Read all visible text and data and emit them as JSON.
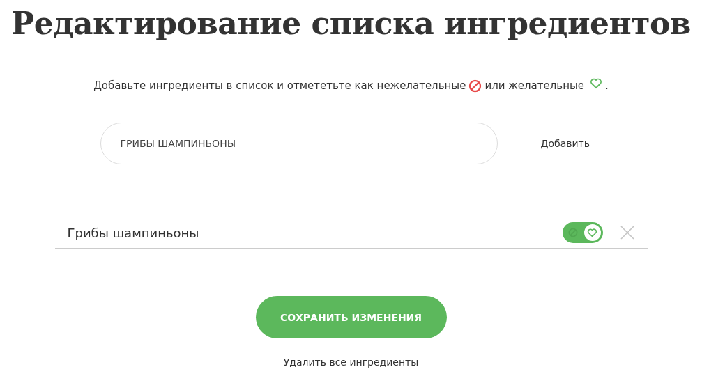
{
  "title": "Редактирование списка ингредиентов",
  "instruction": {
    "before": "Добавьте ингредиенты в список и отмететьте как нежелательные",
    "middle": "или желательные",
    "end": "."
  },
  "add_form": {
    "value": "ГРИБЫ ШАМПИНЬОНЫ",
    "add_link": "Добавить"
  },
  "ingredients": [
    {
      "name": "Грибы шампиньоны",
      "liked": true
    }
  ],
  "save_button": "СОХРАНИТЬ ИЗМЕНЕНИЯ",
  "delete_all_link": "Удалить все ингредиенты"
}
